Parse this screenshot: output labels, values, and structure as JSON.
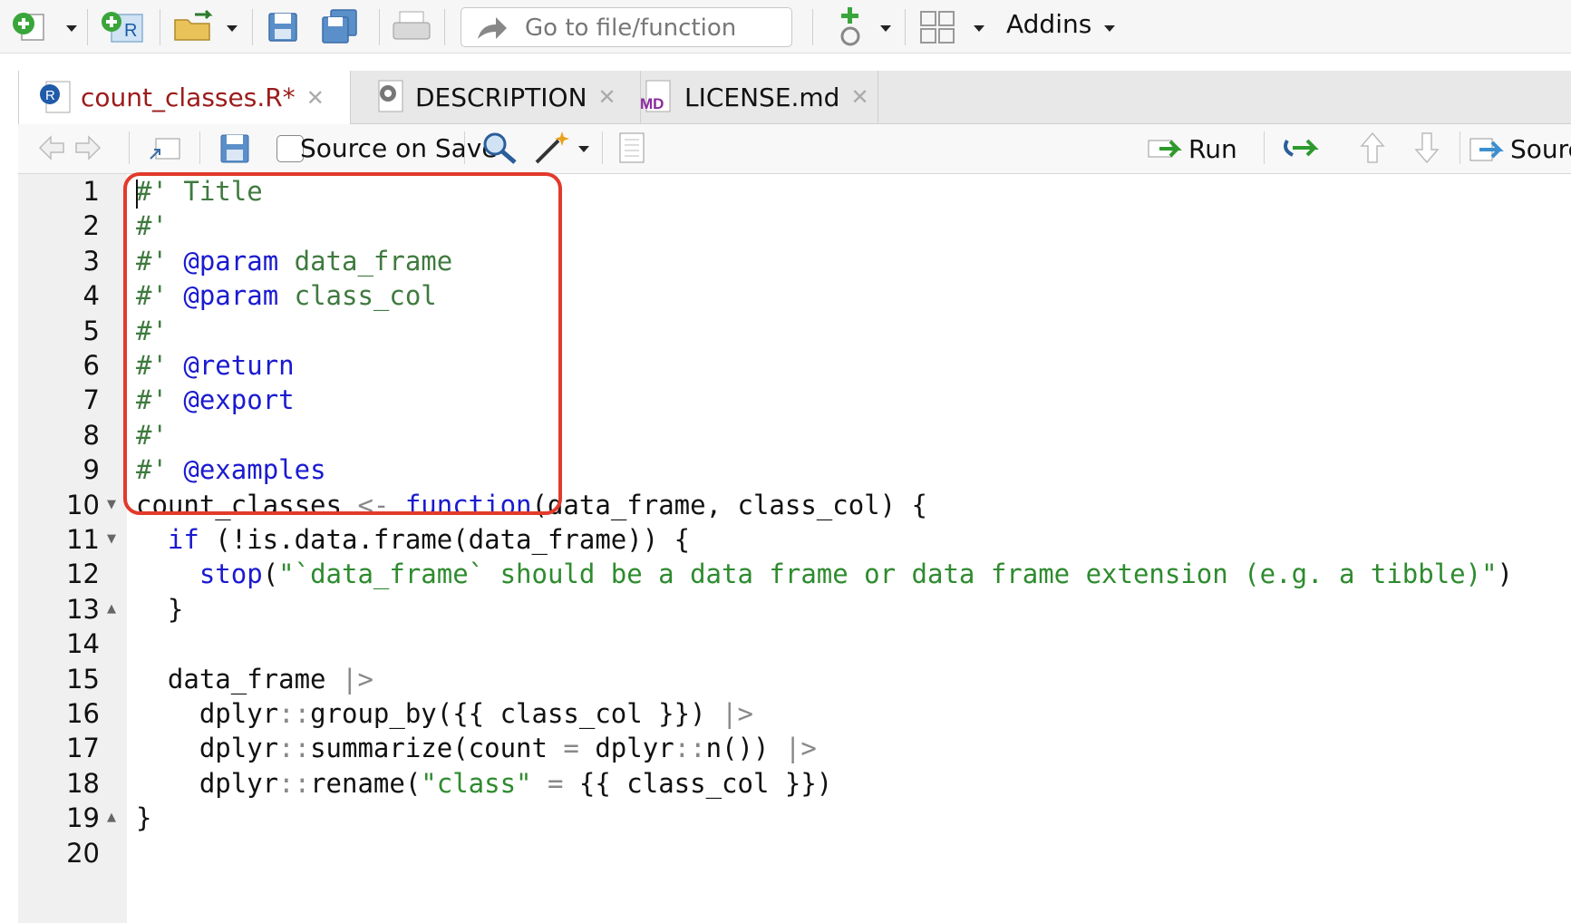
{
  "toolbar": {
    "goto_placeholder": "Go to file/function",
    "addins_label": "Addins"
  },
  "tabs": [
    {
      "label": "count_classes.R*",
      "icon": "r-file-icon",
      "active": true
    },
    {
      "label": "DESCRIPTION",
      "icon": "gear-file-icon",
      "active": false
    },
    {
      "label": "LICENSE.md",
      "icon": "md-file-icon",
      "active": false
    }
  ],
  "editor_toolbar": {
    "source_on_save_label": "Source on Save",
    "source_on_save_checked": false,
    "run_label": "Run",
    "source_label": "Sourc"
  },
  "code": {
    "lines": [
      {
        "n": "1",
        "fold": "",
        "segments": [
          {
            "c": "cm",
            "t": "#' Title"
          }
        ]
      },
      {
        "n": "2",
        "fold": "",
        "segments": [
          {
            "c": "cm",
            "t": "#'"
          }
        ]
      },
      {
        "n": "3",
        "fold": "",
        "segments": [
          {
            "c": "cm",
            "t": "#' "
          },
          {
            "c": "rox",
            "t": "@param"
          },
          {
            "c": "cm",
            "t": " data_frame"
          }
        ]
      },
      {
        "n": "4",
        "fold": "",
        "segments": [
          {
            "c": "cm",
            "t": "#' "
          },
          {
            "c": "rox",
            "t": "@param"
          },
          {
            "c": "cm",
            "t": " class_col"
          }
        ]
      },
      {
        "n": "5",
        "fold": "",
        "segments": [
          {
            "c": "cm",
            "t": "#'"
          }
        ]
      },
      {
        "n": "6",
        "fold": "",
        "segments": [
          {
            "c": "cm",
            "t": "#' "
          },
          {
            "c": "rox",
            "t": "@return"
          }
        ]
      },
      {
        "n": "7",
        "fold": "",
        "segments": [
          {
            "c": "cm",
            "t": "#' "
          },
          {
            "c": "rox",
            "t": "@export"
          }
        ]
      },
      {
        "n": "8",
        "fold": "",
        "segments": [
          {
            "c": "cm",
            "t": "#'"
          }
        ]
      },
      {
        "n": "9",
        "fold": "",
        "segments": [
          {
            "c": "cm",
            "t": "#' "
          },
          {
            "c": "rox",
            "t": "@examples"
          }
        ]
      },
      {
        "n": "10",
        "fold": "▼",
        "segments": [
          {
            "c": "plain",
            "t": "count_classes "
          },
          {
            "c": "op",
            "t": "<-"
          },
          {
            "c": "plain",
            "t": " "
          },
          {
            "c": "kw",
            "t": "function"
          },
          {
            "c": "plain",
            "t": "(data_frame, class_col) {"
          }
        ]
      },
      {
        "n": "11",
        "fold": "▼",
        "segments": [
          {
            "c": "plain",
            "t": "  "
          },
          {
            "c": "kw",
            "t": "if"
          },
          {
            "c": "plain",
            "t": " (!is.data.frame(data_frame)) {"
          }
        ]
      },
      {
        "n": "12",
        "fold": "",
        "segments": [
          {
            "c": "plain",
            "t": "    "
          },
          {
            "c": "kw",
            "t": "stop"
          },
          {
            "c": "plain",
            "t": "("
          },
          {
            "c": "str",
            "t": "\"`data_frame` should be a data frame or data frame extension (e.g. a tibble)\""
          },
          {
            "c": "plain",
            "t": ")"
          }
        ]
      },
      {
        "n": "13",
        "fold": "▲",
        "segments": [
          {
            "c": "plain",
            "t": "  }"
          }
        ]
      },
      {
        "n": "14",
        "fold": "",
        "segments": [
          {
            "c": "plain",
            "t": ""
          }
        ]
      },
      {
        "n": "15",
        "fold": "",
        "segments": [
          {
            "c": "plain",
            "t": "  data_frame "
          },
          {
            "c": "op",
            "t": "|>"
          }
        ]
      },
      {
        "n": "16",
        "fold": "",
        "segments": [
          {
            "c": "plain",
            "t": "    dplyr"
          },
          {
            "c": "op",
            "t": "::"
          },
          {
            "c": "plain",
            "t": "group_by({{ class_col }}) "
          },
          {
            "c": "op",
            "t": "|>"
          }
        ]
      },
      {
        "n": "17",
        "fold": "",
        "segments": [
          {
            "c": "plain",
            "t": "    dplyr"
          },
          {
            "c": "op",
            "t": "::"
          },
          {
            "c": "plain",
            "t": "summarize(count "
          },
          {
            "c": "op",
            "t": "="
          },
          {
            "c": "plain",
            "t": " dplyr"
          },
          {
            "c": "op",
            "t": "::"
          },
          {
            "c": "plain",
            "t": "n()) "
          },
          {
            "c": "op",
            "t": "|>"
          }
        ]
      },
      {
        "n": "18",
        "fold": "",
        "segments": [
          {
            "c": "plain",
            "t": "    dplyr"
          },
          {
            "c": "op",
            "t": "::"
          },
          {
            "c": "plain",
            "t": "rename("
          },
          {
            "c": "str",
            "t": "\"class\""
          },
          {
            "c": "plain",
            "t": " "
          },
          {
            "c": "op",
            "t": "="
          },
          {
            "c": "plain",
            "t": " {{ class_col }})"
          }
        ]
      },
      {
        "n": "19",
        "fold": "▲",
        "segments": [
          {
            "c": "plain",
            "t": "}"
          }
        ]
      },
      {
        "n": "20",
        "fold": "",
        "segments": [
          {
            "c": "plain",
            "t": ""
          }
        ]
      }
    ]
  },
  "colors": {
    "highlight_box": "#e23a2b",
    "comment": "#3f7a3f",
    "keyword": "#1a1ad0",
    "string": "#2e8b2e"
  }
}
